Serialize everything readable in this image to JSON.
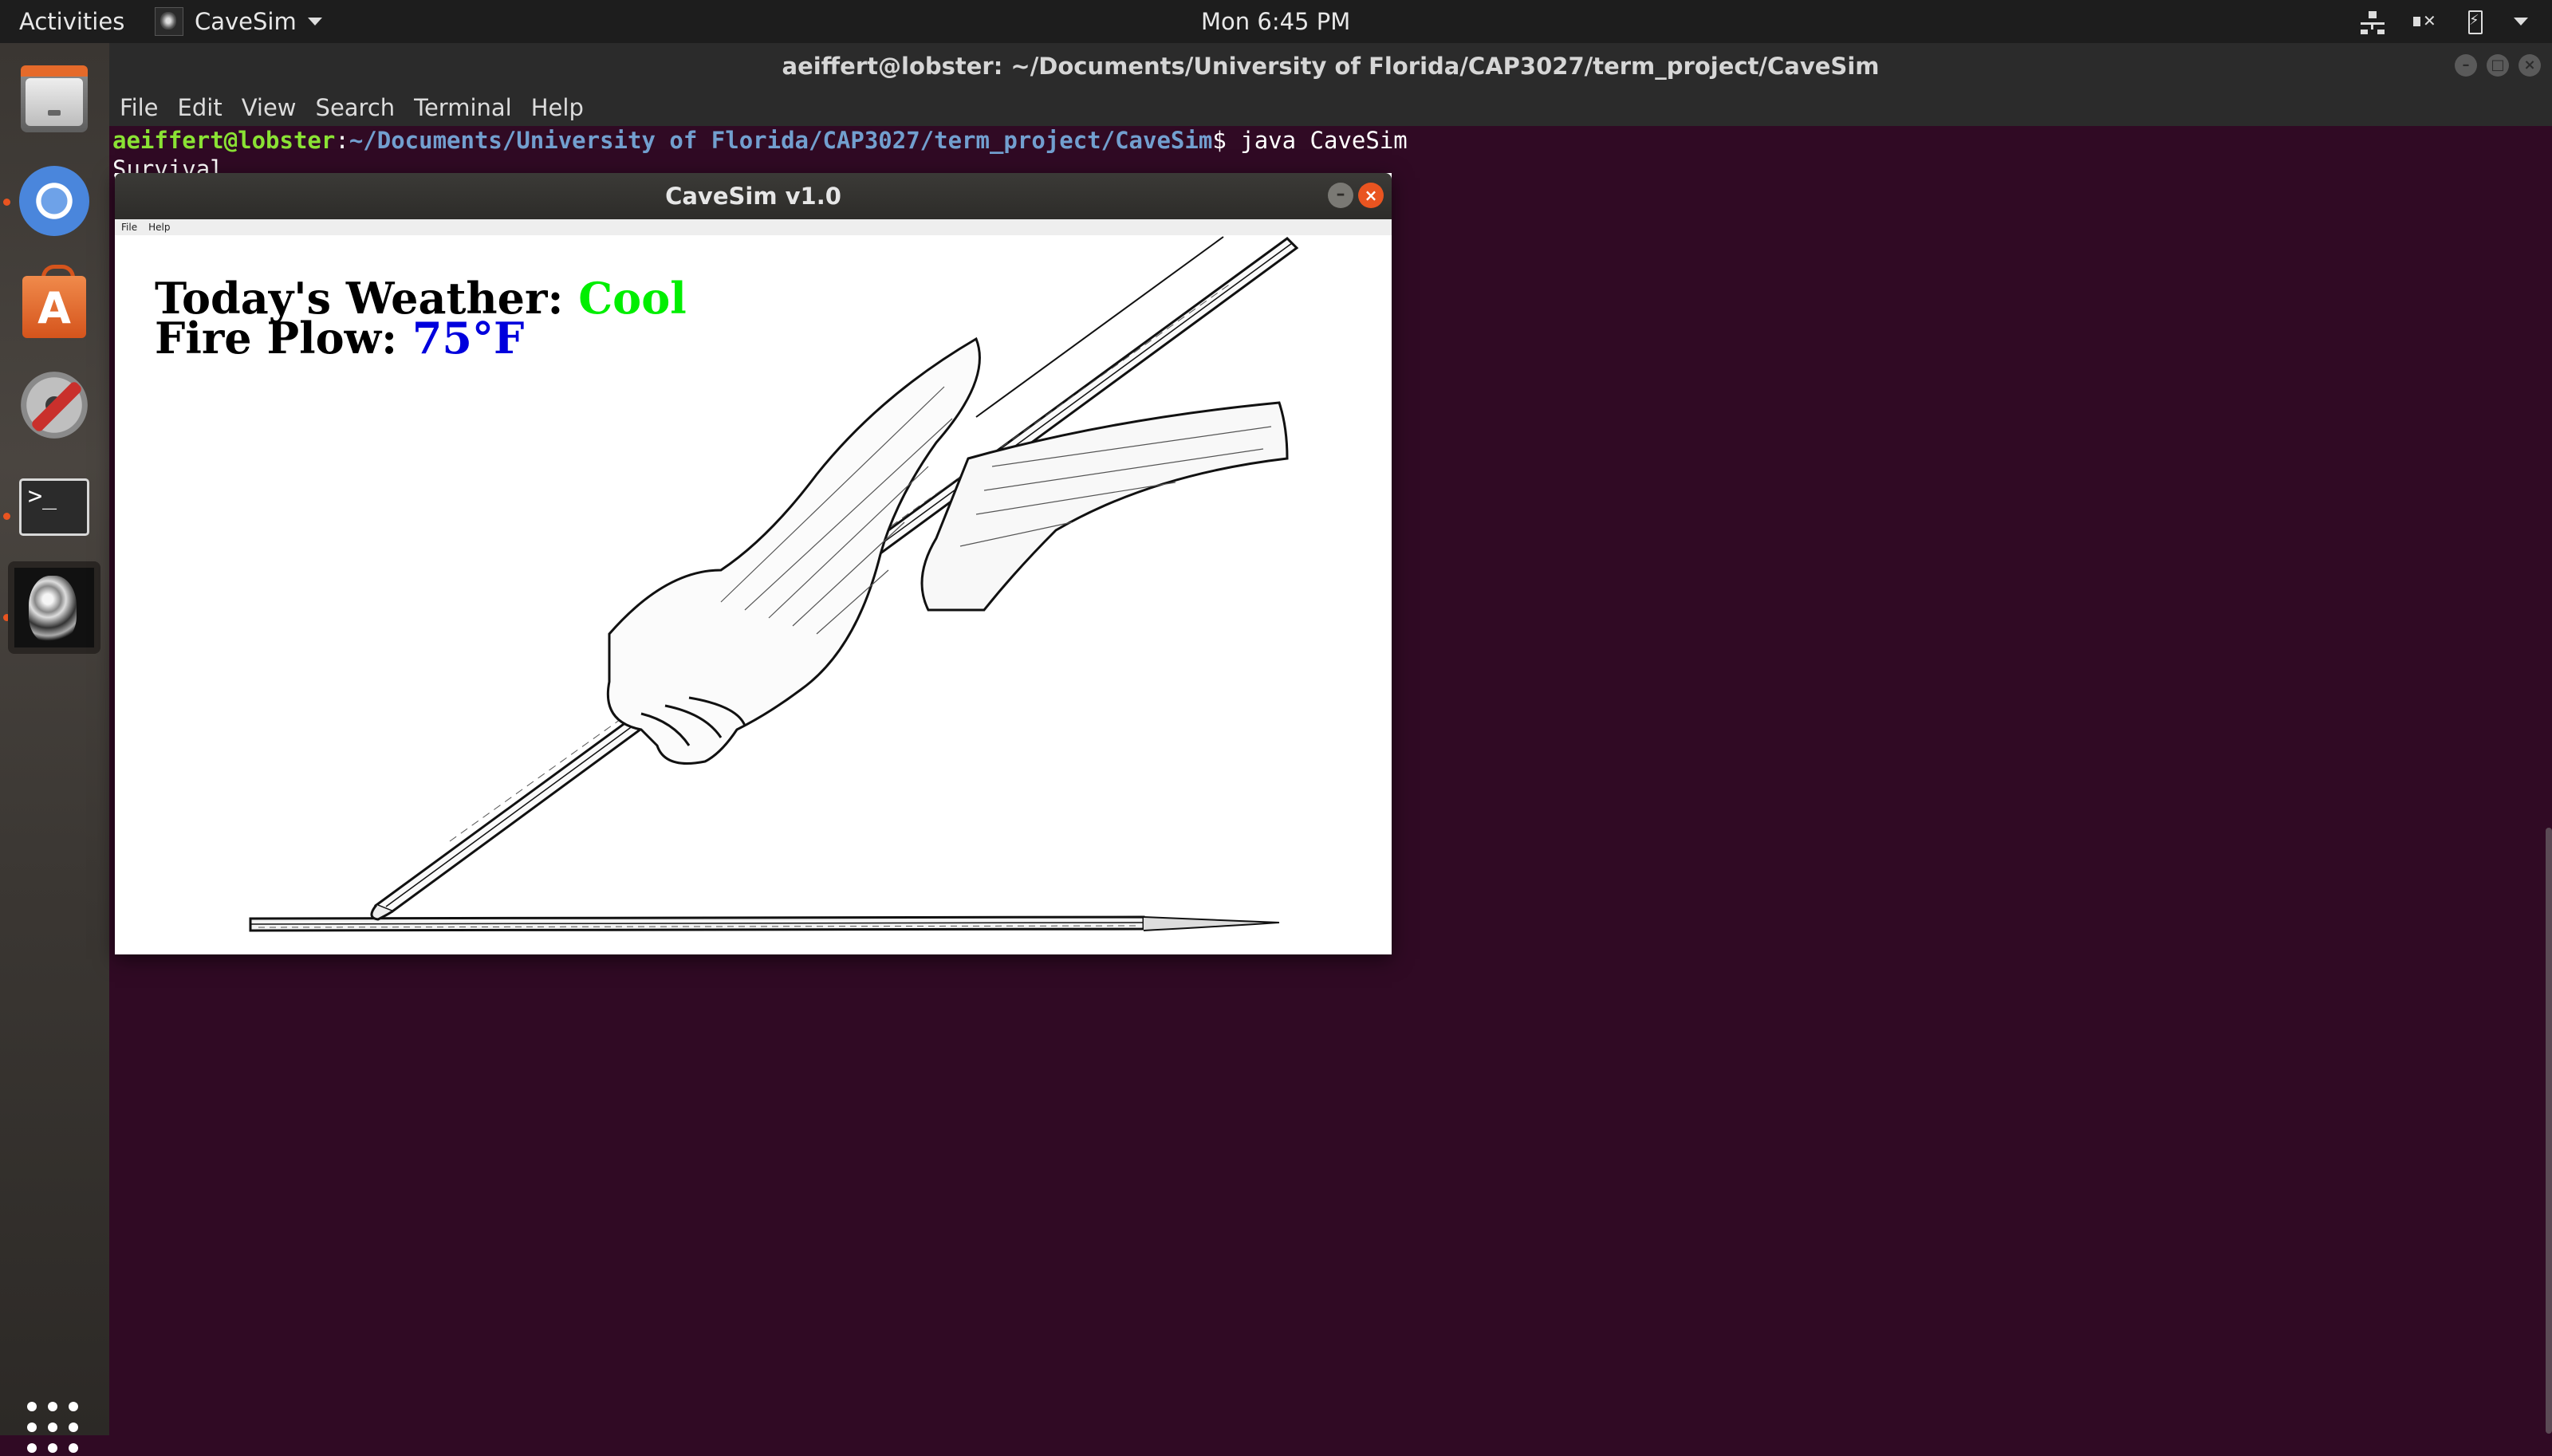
{
  "topbar": {
    "activities": "Activities",
    "app_name": "CaveSim",
    "clock": "Mon  6:45 PM"
  },
  "dock": {
    "items": [
      "files",
      "chromium",
      "ubuntu-software",
      "settings",
      "terminal",
      "cavesim"
    ]
  },
  "terminal": {
    "title": "aeiffert@lobster: ~/Documents/University of Florida/CAP3027/term_project/CaveSim",
    "menu": [
      "File",
      "Edit",
      "View",
      "Search",
      "Terminal",
      "Help"
    ],
    "prompt_user": "aeiffert@lobster",
    "prompt_sep": ":",
    "prompt_path": "~/Documents/University of Florida/CAP3027/term_project/CaveSim",
    "prompt_end": "$ ",
    "command": "java CaveSim",
    "output": "Survival"
  },
  "cavesim": {
    "title": "CaveSim v1.0",
    "menu": [
      "File",
      "Help"
    ],
    "weather_label": "Today's Weather: ",
    "weather_value": "Cool",
    "plow_label": "Fire Plow: ",
    "plow_value": "75°F"
  },
  "colors": {
    "terminal_bg": "#300a24",
    "prompt_user": "#8ae234",
    "prompt_path": "#729fcf",
    "weather_value": "#00ee00",
    "plow_value": "#0000dd",
    "accent": "#e95420"
  }
}
